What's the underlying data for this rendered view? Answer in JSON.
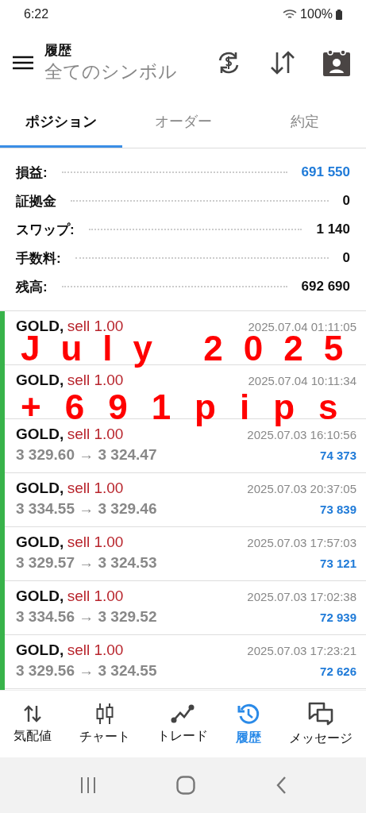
{
  "status_bar": {
    "time": "6:22",
    "battery": "100%"
  },
  "header": {
    "title": "履歴",
    "subtitle": "全てのシンボル"
  },
  "tabs": [
    {
      "label": "ポジション",
      "selected": true
    },
    {
      "label": "オーダー",
      "selected": false
    },
    {
      "label": "約定",
      "selected": false
    }
  ],
  "summary": [
    {
      "label": "損益:",
      "value": "691 550",
      "highlight": true
    },
    {
      "label": "証拠金",
      "value": "0",
      "highlight": false
    },
    {
      "label": "スワップ:",
      "value": "1 140",
      "highlight": false
    },
    {
      "label": "手数料:",
      "value": "0",
      "highlight": false
    },
    {
      "label": "残高:",
      "value": "692 690",
      "highlight": false
    }
  ],
  "positions": [
    {
      "symbol": "GOLD,",
      "side": "sell 1.00",
      "time": "2025.07.04 01:11:05"
    },
    {
      "symbol": "GOLD,",
      "side": "sell 1.00",
      "time": "2025.07.04 10:11:34"
    },
    {
      "symbol": "GOLD,",
      "side": "sell 1.00",
      "time": "2025.07.03 16:10:56",
      "prices": "3 329.60 → 3 324.47",
      "profit": "74 373"
    },
    {
      "symbol": "GOLD,",
      "side": "sell 1.00",
      "time": "2025.07.03 20:37:05",
      "prices": "3 334.55 → 3 329.46",
      "profit": "73 839"
    },
    {
      "symbol": "GOLD,",
      "side": "sell 1.00",
      "time": "2025.07.03 17:57:03",
      "prices": "3 329.57 → 3 324.53",
      "profit": "73 121"
    },
    {
      "symbol": "GOLD,",
      "side": "sell 1.00",
      "time": "2025.07.03 17:02:38",
      "prices": "3 334.56 → 3 329.52",
      "profit": "72 939"
    },
    {
      "symbol": "GOLD,",
      "side": "sell 1.00",
      "time": "2025.07.03 17:23:21",
      "prices": "3 329.56 → 3 324.55",
      "profit": "72 626"
    }
  ],
  "overlay": [
    "July 2025",
    "+691pips"
  ],
  "bottom_nav": [
    {
      "kind": "quotes",
      "label": "気配値",
      "selected": false
    },
    {
      "kind": "chart",
      "label": "チャート",
      "selected": false
    },
    {
      "kind": "trade",
      "label": "トレード",
      "selected": false
    },
    {
      "kind": "history",
      "label": "履歴",
      "selected": true
    },
    {
      "kind": "messages",
      "label": "メッセージ",
      "selected": false
    }
  ]
}
